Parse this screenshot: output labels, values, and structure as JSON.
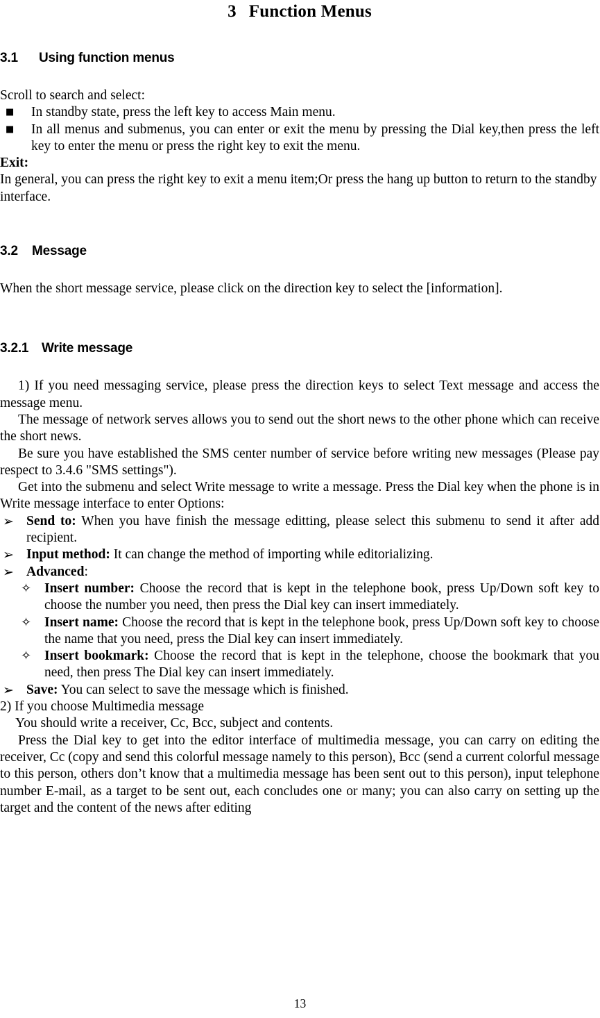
{
  "document": {
    "page_number": "13",
    "chapter": {
      "number": "3",
      "title": "Function Menus"
    },
    "sections": {
      "s31": {
        "number": "3.1",
        "title": "Using function menus",
        "intro": "Scroll to search and select:",
        "bullets": [
          "In standby state, press the left key to access Main menu.",
          "In all menus and submenus, you can enter or exit the menu by pressing the Dial key,then press the left key to enter the menu or press the right key to exit the menu."
        ],
        "exit_label": "Exit:",
        "exit_text": "In general, you can press the right key to exit a menu item;Or press the hang up button to return to the standby interface."
      },
      "s32": {
        "number": "3.2",
        "title": "Message",
        "intro": "When the short message service, please click on the direction key to select the [information]."
      },
      "s321": {
        "number": "3.2.1",
        "title": "Write message",
        "para1": "1) If you need messaging service, please press the direction keys to select Text message and access the message menu.",
        "para2": "The message of network serves allows you to send out the short news to the other phone which can receive the short news.",
        "para3": "Be sure you have established the SMS center number of service before writing new messages (Please pay respect to 3.4.6 \"SMS settings\").",
        "para4": "Get into the submenu and select Write message to write a message. Press the Dial key when the phone is in Write message interface to enter Options:",
        "options": [
          {
            "term": "Send to:",
            "text": " When you have finish the message editting, please select this submenu to send it after add recipient."
          },
          {
            "term": "Input method:",
            "text": " It can change the method of importing while editorializing."
          },
          {
            "term": "Advanced",
            "text": ":"
          },
          {
            "term": "Save:",
            "text": " You can select to save the message which is finished."
          }
        ],
        "advanced_subitems": [
          {
            "term": "Insert number:",
            "text": " Choose the record that is kept in the telephone book, press Up/Down soft key to choose the number you need, then press the Dial key can insert immediately."
          },
          {
            "term": "Insert name:",
            "text": " Choose the record that is kept in the telephone book, press Up/Down soft key to choose the name that you need, press the Dial key can insert immediately."
          },
          {
            "term": "Insert bookmark:",
            "text": " Choose the record that is kept in the telephone, choose the bookmark that you need, then press The Dial key can insert immediately."
          }
        ],
        "item2": "2)    If    you choose Multimedia message",
        "item2_line2": "You should write a receiver, Cc, Bcc, subject and contents.",
        "para5": "Press the Dial key to get into the editor interface of multimedia message, you can carry on editing the receiver, Cc (copy and send this colorful message namely to this person), Bcc (send a current colorful message to this person, others don’t know that a multimedia message has been sent out to this person), input telephone number E-mail, as a target to be sent out, each concludes one or many; you can also carry on setting up the target and the content of the news after editing"
      }
    },
    "markers": {
      "square_bullet": "■",
      "arrow_bullet": "➢",
      "diamond_bullet": "✧"
    }
  }
}
